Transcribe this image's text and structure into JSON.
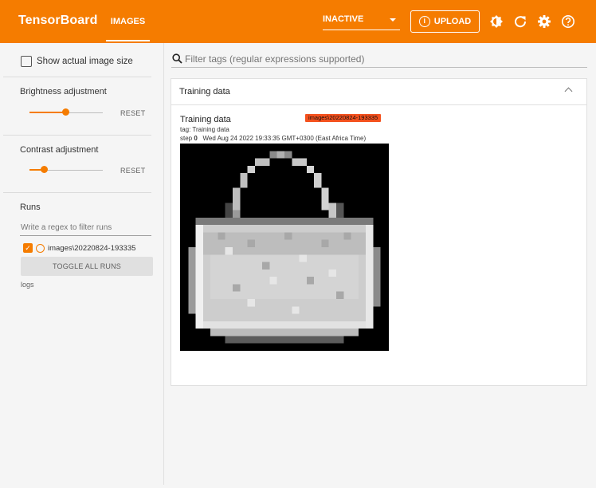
{
  "topbar": {
    "brand": "TensorBoard",
    "active_tab": "IMAGES",
    "mode_select": "INACTIVE",
    "upload_label": "UPLOAD",
    "colors": {
      "bar": "#f57c00"
    }
  },
  "sidebar": {
    "show_actual_size_label": "Show actual image size",
    "brightness": {
      "label": "Brightness adjustment",
      "reset": "RESET",
      "value_fraction": 0.5
    },
    "contrast": {
      "label": "Contrast adjustment",
      "reset": "RESET",
      "value_fraction": 0.2
    },
    "runs": {
      "label": "Runs",
      "filter_placeholder": "Write a regex to filter runs",
      "items": [
        {
          "name": "images\\20220824-193335",
          "checked": true
        }
      ],
      "toggle_all": "TOGGLE ALL RUNS",
      "logdir": "logs"
    }
  },
  "main": {
    "search_placeholder": "Filter tags (regular expressions supported)",
    "card": {
      "title": "Training data",
      "image": {
        "title": "Training data",
        "run_badge": "images\\20220824-193335",
        "tag": "tag: Training data",
        "step_label": "step",
        "step_value": "0",
        "timestamp": "Wed Aug 24 2022 19:33:35 GMT+0300 (East Africa Time)"
      }
    }
  }
}
